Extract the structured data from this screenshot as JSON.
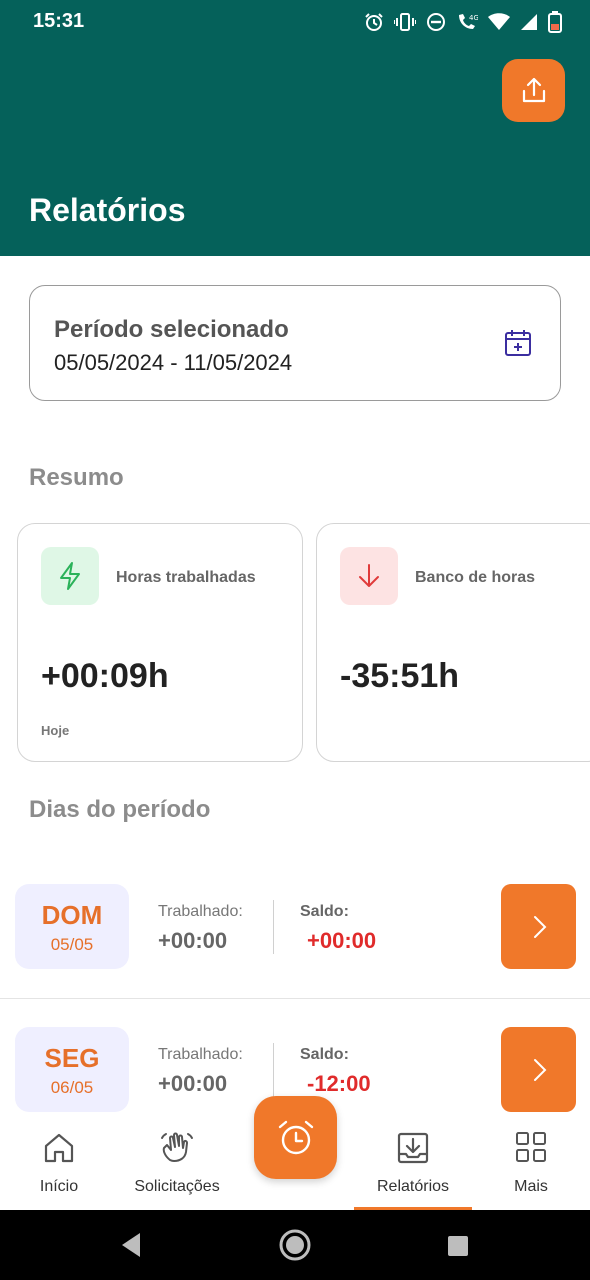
{
  "status_bar": {
    "time": "15:31"
  },
  "header": {
    "title": "Relatórios",
    "share_icon": "share-upload-icon"
  },
  "period": {
    "label": "Período selecionado",
    "value": "05/05/2024 - 11/05/2024",
    "icon": "calendar-add-icon"
  },
  "summary": {
    "title": "Resumo",
    "cards": [
      {
        "label": "Horas trabalhadas",
        "value": "+00:09h",
        "note": "Hoje",
        "icon": "lightning-icon",
        "icon_bg": "#dff7e6",
        "icon_color": "#2bb25a"
      },
      {
        "label": "Banco de horas",
        "value": "-35:51h",
        "note": "",
        "icon": "arrow-down-icon",
        "icon_bg": "#fde3e3",
        "icon_color": "#e03b3b"
      }
    ]
  },
  "days": {
    "title": "Dias do período",
    "worked_label": "Trabalhado:",
    "balance_label": "Saldo:",
    "items": [
      {
        "day": "DOM",
        "date": "05/05",
        "worked": "+00:00",
        "balance": "+00:00"
      },
      {
        "day": "SEG",
        "date": "06/05",
        "worked": "+00:00",
        "balance": "-12:00"
      }
    ]
  },
  "nav": {
    "items": [
      {
        "label": "Início",
        "icon": "home-icon"
      },
      {
        "label": "Solicitações",
        "icon": "waving-hand-icon"
      },
      {
        "label": "Relatórios",
        "icon": "download-tray-icon",
        "active": true
      },
      {
        "label": "Mais",
        "icon": "grid-icon"
      }
    ],
    "fab_icon": "alarm-clock-icon"
  },
  "colors": {
    "primary": "#05615a",
    "accent": "#f0782a",
    "negative": "#e02b2b"
  }
}
